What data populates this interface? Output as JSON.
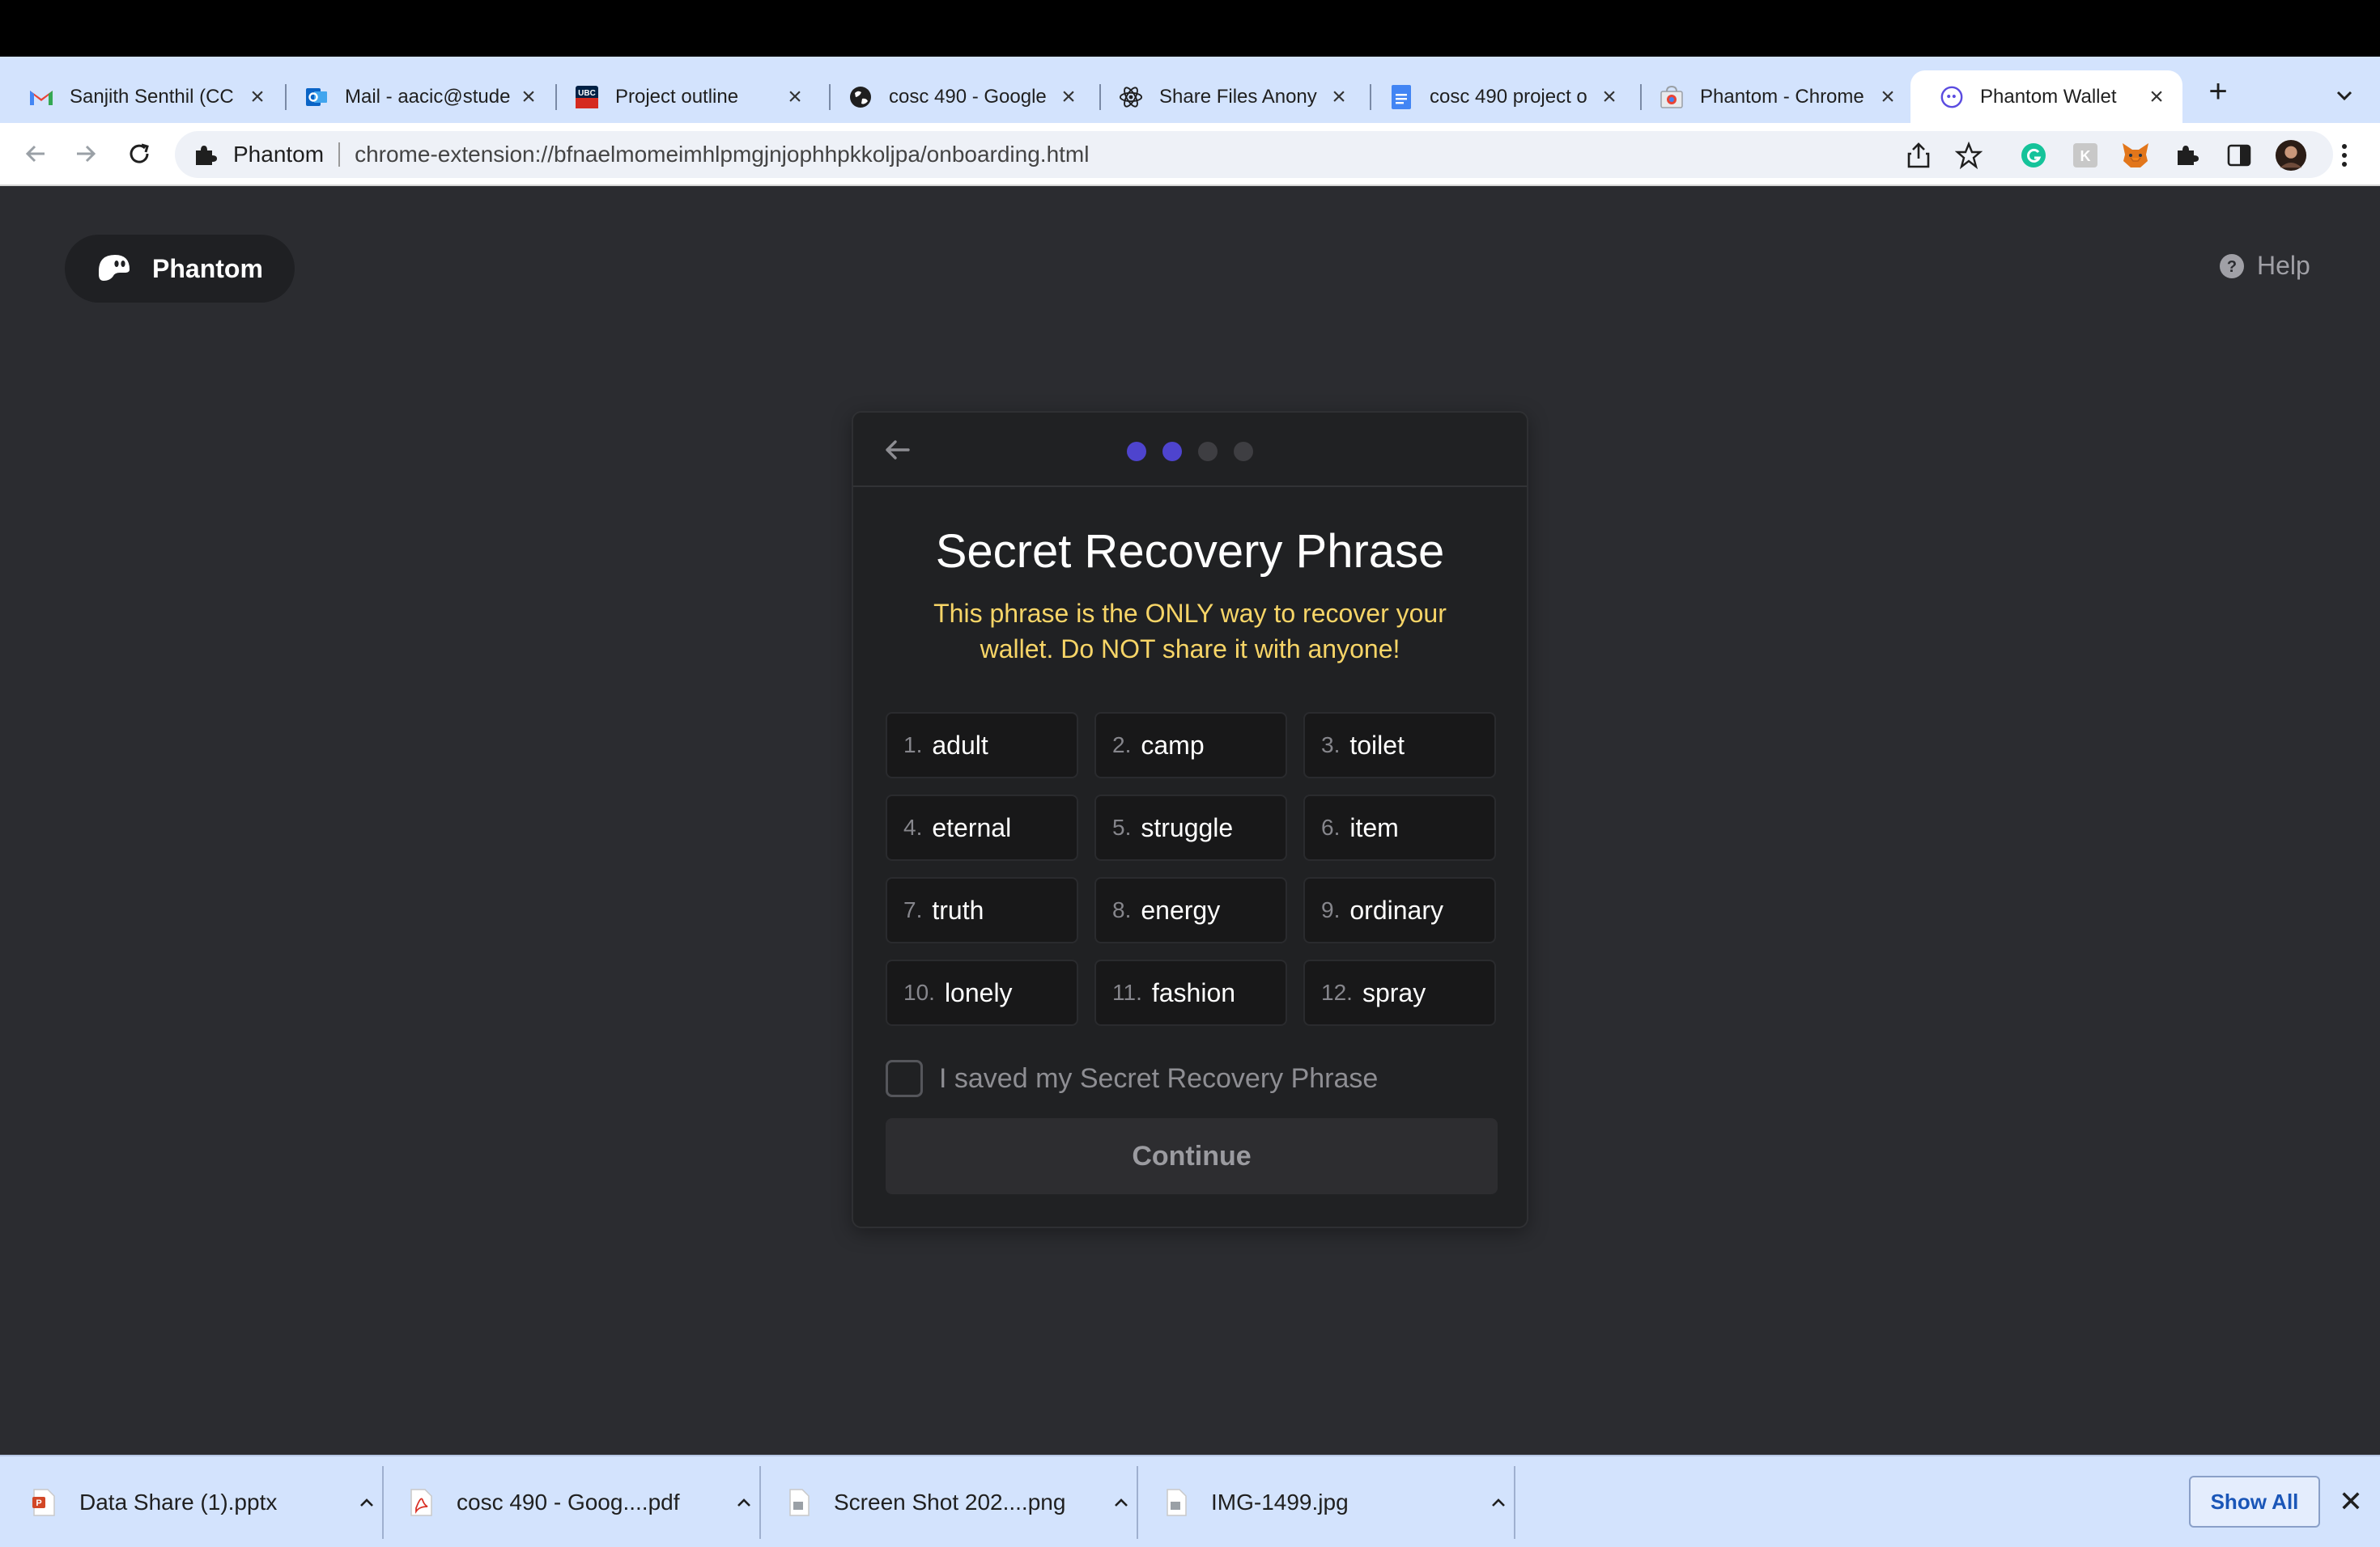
{
  "browser": {
    "tabs": [
      {
        "title": "Sanjith Senthil (CC",
        "icon": "gmail-icon"
      },
      {
        "title": "Mail - aacic@stude",
        "icon": "outlook-icon"
      },
      {
        "title": "Project outline",
        "icon": "ubc-canvas-icon"
      },
      {
        "title": "cosc 490 - Google",
        "icon": "globe-icon"
      },
      {
        "title": "Share Files Anony",
        "icon": "react-icon"
      },
      {
        "title": "cosc 490 project o",
        "icon": "google-docs-icon"
      },
      {
        "title": "Phantom - Chrome",
        "icon": "chrome-webstore-icon"
      },
      {
        "title": "Phantom Wallet",
        "icon": "phantom-icon",
        "active": true
      }
    ],
    "new_tab_label": "+",
    "omnibox": {
      "site_name": "Phantom",
      "url": "chrome-extension://bfnaelmomeimhlpmgjnjophhpkkoljpa/onboarding.html"
    }
  },
  "page": {
    "brand": "Phantom",
    "help_label": "Help",
    "card": {
      "step_dots": {
        "total": 4,
        "completed": 2,
        "active_color": "#4e44ce",
        "inactive_color": "#3e3e42"
      },
      "title": "Secret Recovery Phrase",
      "warning": "This phrase is the ONLY way to recover your wallet. Do NOT share it with anyone!",
      "words": [
        {
          "num": "1.",
          "word": "adult"
        },
        {
          "num": "2.",
          "word": "camp"
        },
        {
          "num": "3.",
          "word": "toilet"
        },
        {
          "num": "4.",
          "word": "eternal"
        },
        {
          "num": "5.",
          "word": "struggle"
        },
        {
          "num": "6.",
          "word": "item"
        },
        {
          "num": "7.",
          "word": "truth"
        },
        {
          "num": "8.",
          "word": "energy"
        },
        {
          "num": "9.",
          "word": "ordinary"
        },
        {
          "num": "10.",
          "word": "lonely"
        },
        {
          "num": "11.",
          "word": "fashion"
        },
        {
          "num": "12.",
          "word": "spray"
        }
      ],
      "checkbox_label": "I saved my Secret Recovery Phrase",
      "checkbox_checked": false,
      "continue_label": "Continue"
    }
  },
  "downloads": {
    "items": [
      {
        "name": "Data Share (1).pptx",
        "icon": "pptx-file-icon"
      },
      {
        "name": "cosc 490 - Goog....pdf",
        "icon": "pdf-file-icon"
      },
      {
        "name": "Screen Shot 202....png",
        "icon": "image-file-icon"
      },
      {
        "name": "IMG-1499.jpg",
        "icon": "image-file-icon"
      }
    ],
    "show_all_label": "Show All"
  },
  "colors": {
    "page_bg": "#2b2c30",
    "card_bg": "#202123",
    "warning": "#f7d567",
    "tabstrip": "#d3e3fd",
    "accent": "#4e44ce"
  }
}
